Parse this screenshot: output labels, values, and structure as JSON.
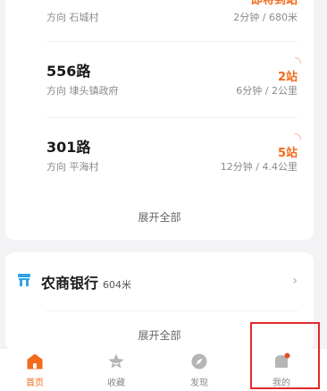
{
  "routes": [
    {
      "name": "",
      "direction": "方向 石城村",
      "status": "即将到站",
      "eta": "2分钟 / 680米"
    },
    {
      "name": "556路",
      "direction": "方向 埭头镇政府",
      "status": "2站",
      "eta": "6分钟 / 2公里"
    },
    {
      "name": "301路",
      "direction": "方向 平海村",
      "status": "5站",
      "eta": "12分钟 / 4.4公里"
    }
  ],
  "routes_expand_label": "展开全部",
  "bank": {
    "name": "农商银行",
    "distance": "604米",
    "expand_label": "展开全部"
  },
  "tabs": [
    {
      "label": "首页",
      "icon": "home-icon",
      "active": true
    },
    {
      "label": "收藏",
      "icon": "star-icon",
      "active": false
    },
    {
      "label": "发现",
      "icon": "compass-icon",
      "active": false
    },
    {
      "label": "我的",
      "icon": "profile-icon",
      "active": false,
      "badge": true
    }
  ],
  "colors": {
    "accent": "#f26a1b",
    "highlight": "#e12a2a",
    "bank_icon": "#2fa3e6"
  }
}
